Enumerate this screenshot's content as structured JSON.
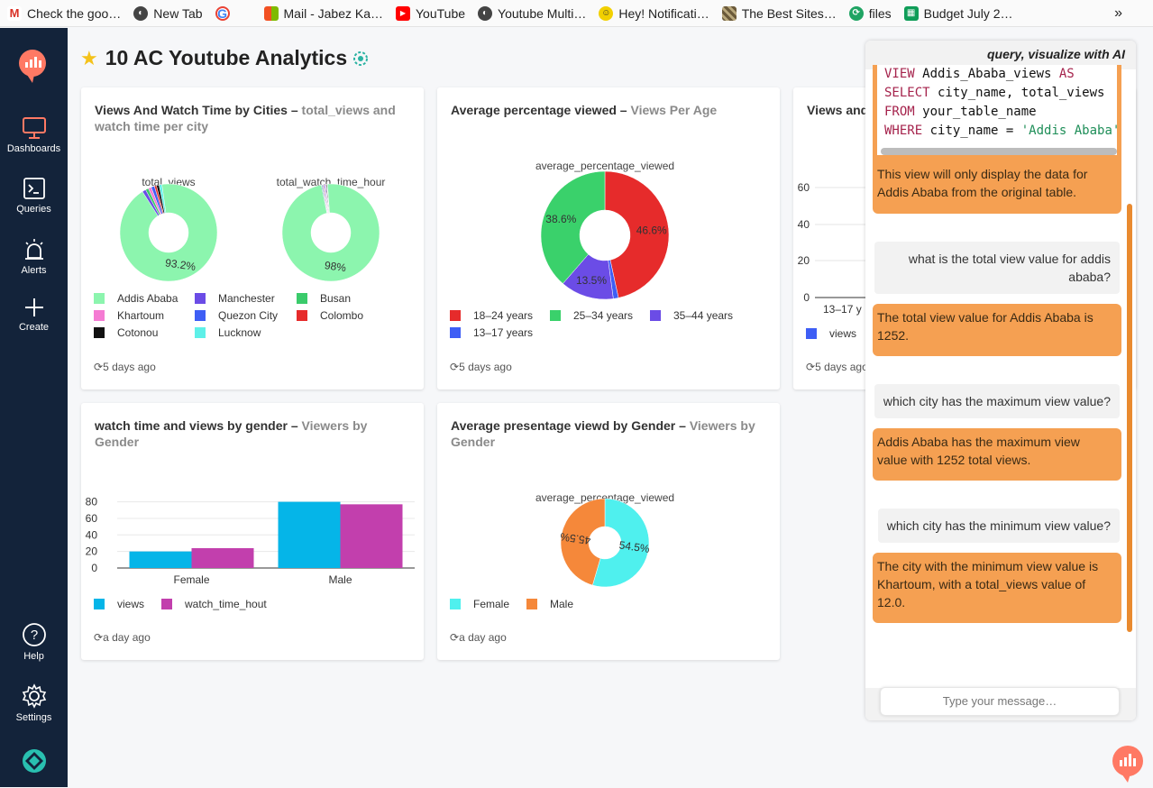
{
  "bookmarks": [
    {
      "label": "Check the goo…",
      "icon": "gmail-icon",
      "color": "#d93025"
    },
    {
      "label": "New Tab",
      "icon": "globe-icon",
      "color": "#555555"
    },
    {
      "label": "",
      "icon": "google-icon",
      "color": "#4285f4"
    },
    {
      "label": "Mail - Jabez Ka…",
      "icon": "microsoft-icon",
      "color": "#f25022"
    },
    {
      "label": "YouTube",
      "icon": "youtube-icon",
      "color": "#ff0000"
    },
    {
      "label": "Youtube Multi…",
      "icon": "globe-icon",
      "color": "#555555"
    },
    {
      "label": "Hey! Notificati…",
      "icon": "hey-icon",
      "color": "#e5c100"
    },
    {
      "label": "The Best Sites…",
      "icon": "site-icon",
      "color": "#7a6a4a"
    },
    {
      "label": "files",
      "icon": "files-icon",
      "color": "#1fa463"
    },
    {
      "label": "Budget July 2…",
      "icon": "sheets-icon",
      "color": "#0f9d58"
    }
  ],
  "bookmarks_more": "»",
  "sidebar": {
    "items": [
      {
        "label": "Dashboards",
        "icon": "monitor-icon"
      },
      {
        "label": "Queries",
        "icon": "terminal-icon"
      },
      {
        "label": "Alerts",
        "icon": "alarm-icon"
      },
      {
        "label": "Create",
        "icon": "plus-icon"
      },
      {
        "label": "Help",
        "icon": "help-icon"
      },
      {
        "label": "Settings",
        "icon": "gear-icon"
      }
    ],
    "accent": "#ff7964"
  },
  "dashboard": {
    "title": "10 AC Youtube Analytics"
  },
  "cards": {
    "cities": {
      "title": "Views And Watch Time by Cities",
      "sep": " – ",
      "subtitle": "total_views and watch time per city",
      "updated": "5 days ago",
      "pie1_label": "total_views",
      "pie1_pct": "93.2%",
      "pie2_label": "total_watch_time_hour",
      "pie2_pct": "98%",
      "legend": [
        "Addis Ababa",
        "Manchester",
        "Busan",
        "Khartoum",
        "Quezon City",
        "Colombo",
        "Cotonou",
        "Lucknow"
      ],
      "legend_colors": [
        "#8cf5ae",
        "#6b4ce6",
        "#3acb6b",
        "#f57bd3",
        "#3e5ef5",
        "#e62b2b",
        "#111111",
        "#5ef0e8"
      ]
    },
    "age": {
      "title": "Average percentage viewed",
      "sep": " – ",
      "subtitle": "Views Per Age",
      "updated": "5 days ago",
      "pie_label": "average_percentage_viewed",
      "legend": [
        "18–24 years",
        "25–34 years",
        "35–44 years",
        "13–17 years"
      ]
    },
    "partial": {
      "title": "Views and",
      "updated": "5 days ago",
      "yticks": [
        "0",
        "20",
        "40",
        "60"
      ],
      "xtick": "13–17 y",
      "legend": "views"
    },
    "gender_bar": {
      "title": "watch time and views by gender",
      "sep": " – ",
      "subtitle": "Viewers by Gender",
      "updated": "a day ago",
      "legend": [
        "views",
        "watch_time_hout"
      ]
    },
    "gender_pie": {
      "title": "Average presentage viewd by Gender",
      "sep": " – ",
      "subtitle": "Viewers by Gender",
      "updated": "a day ago",
      "pie_label": "average_percentage_viewed",
      "legend": [
        "Female",
        "Male"
      ]
    }
  },
  "chart_data": [
    {
      "type": "pie",
      "title": "total_views",
      "categories": [
        "Addis Ababa",
        "Manchester",
        "Busan",
        "Khartoum",
        "Quezon City",
        "Colombo",
        "Cotonou",
        "Lucknow"
      ],
      "values": [
        93.2,
        1.2,
        1.0,
        1.0,
        1.1,
        0.7,
        0.9,
        0.9
      ],
      "colors": [
        "#8cf5ae",
        "#6b4ce6",
        "#3acb6b",
        "#f57bd3",
        "#3e5ef5",
        "#e62b2b",
        "#111111",
        "#5ef0e8"
      ],
      "data_labels": [
        "93.2%"
      ]
    },
    {
      "type": "pie",
      "title": "total_watch_time_hour",
      "categories": [
        "Addis Ababa",
        "Manchester",
        "Busan",
        "Khartoum",
        "Quezon City",
        "Colombo",
        "Cotonou",
        "Lucknow"
      ],
      "values": [
        98,
        0.3,
        0.3,
        0.4,
        0.3,
        0.2,
        0.3,
        0.2
      ],
      "colors": [
        "#8cf5ae",
        "#6b4ce6",
        "#3acb6b",
        "#f57bd3",
        "#3e5ef5",
        "#e62b2b",
        "#111111",
        "#5ef0e8"
      ],
      "data_labels": [
        "98%"
      ]
    },
    {
      "type": "pie",
      "title": "average_percentage_viewed",
      "categories": [
        "18–24 years",
        "13–17 years",
        "35–44 years",
        "25–34 years"
      ],
      "values": [
        46.6,
        1.3,
        13.5,
        38.6
      ],
      "colors": [
        "#e62b2b",
        "#3e5ef5",
        "#6b4ce6",
        "#3ad16b"
      ],
      "data_labels": [
        "46.6%",
        "",
        "13.5%",
        "38.6%"
      ]
    },
    {
      "type": "bar",
      "categories": [
        "Female",
        "Male"
      ],
      "series": [
        {
          "name": "views",
          "values": [
            20,
            80
          ],
          "color": "#05b5e8"
        },
        {
          "name": "watch_time_hout",
          "values": [
            24,
            77
          ],
          "color": "#c23fad"
        }
      ],
      "yticks": [
        0,
        20,
        40,
        60,
        80
      ],
      "ylim": [
        0,
        85
      ]
    },
    {
      "type": "pie",
      "title": "average_percentage_viewed",
      "categories": [
        "Female",
        "Male"
      ],
      "values": [
        54.5,
        45.5
      ],
      "colors": [
        "#4ff0ee",
        "#f5883a"
      ],
      "data_labels": [
        "54.5%",
        "45.5%"
      ]
    }
  ],
  "chat": {
    "title": "query, visualize with AI",
    "code_lines": [
      [
        "VIEW Addis_Ababa_views AS"
      ],
      [
        "SELECT city_name, total_views"
      ],
      [
        "FROM your_table_name"
      ],
      [
        "WHERE city_name = 'Addis Ababa';"
      ]
    ],
    "code_note": "This view will only display the data for Addis Ababa from the original table.",
    "messages": [
      {
        "role": "user",
        "text": "what is the total view value for addis ababa?"
      },
      {
        "role": "ai",
        "text": "The total view value for Addis Ababa is 1252."
      },
      {
        "role": "user",
        "text": "which city has the maximum view value?"
      },
      {
        "role": "ai",
        "text": "Addis Ababa has the maximum view value with 1252 total views."
      },
      {
        "role": "user",
        "text": "which city has the minimum view value?"
      },
      {
        "role": "ai",
        "text": "The city with the minimum view value is Khartoum, with a total_views value of 12.0."
      }
    ],
    "input_placeholder": "Type your message…",
    "accent": "#f5a052"
  }
}
